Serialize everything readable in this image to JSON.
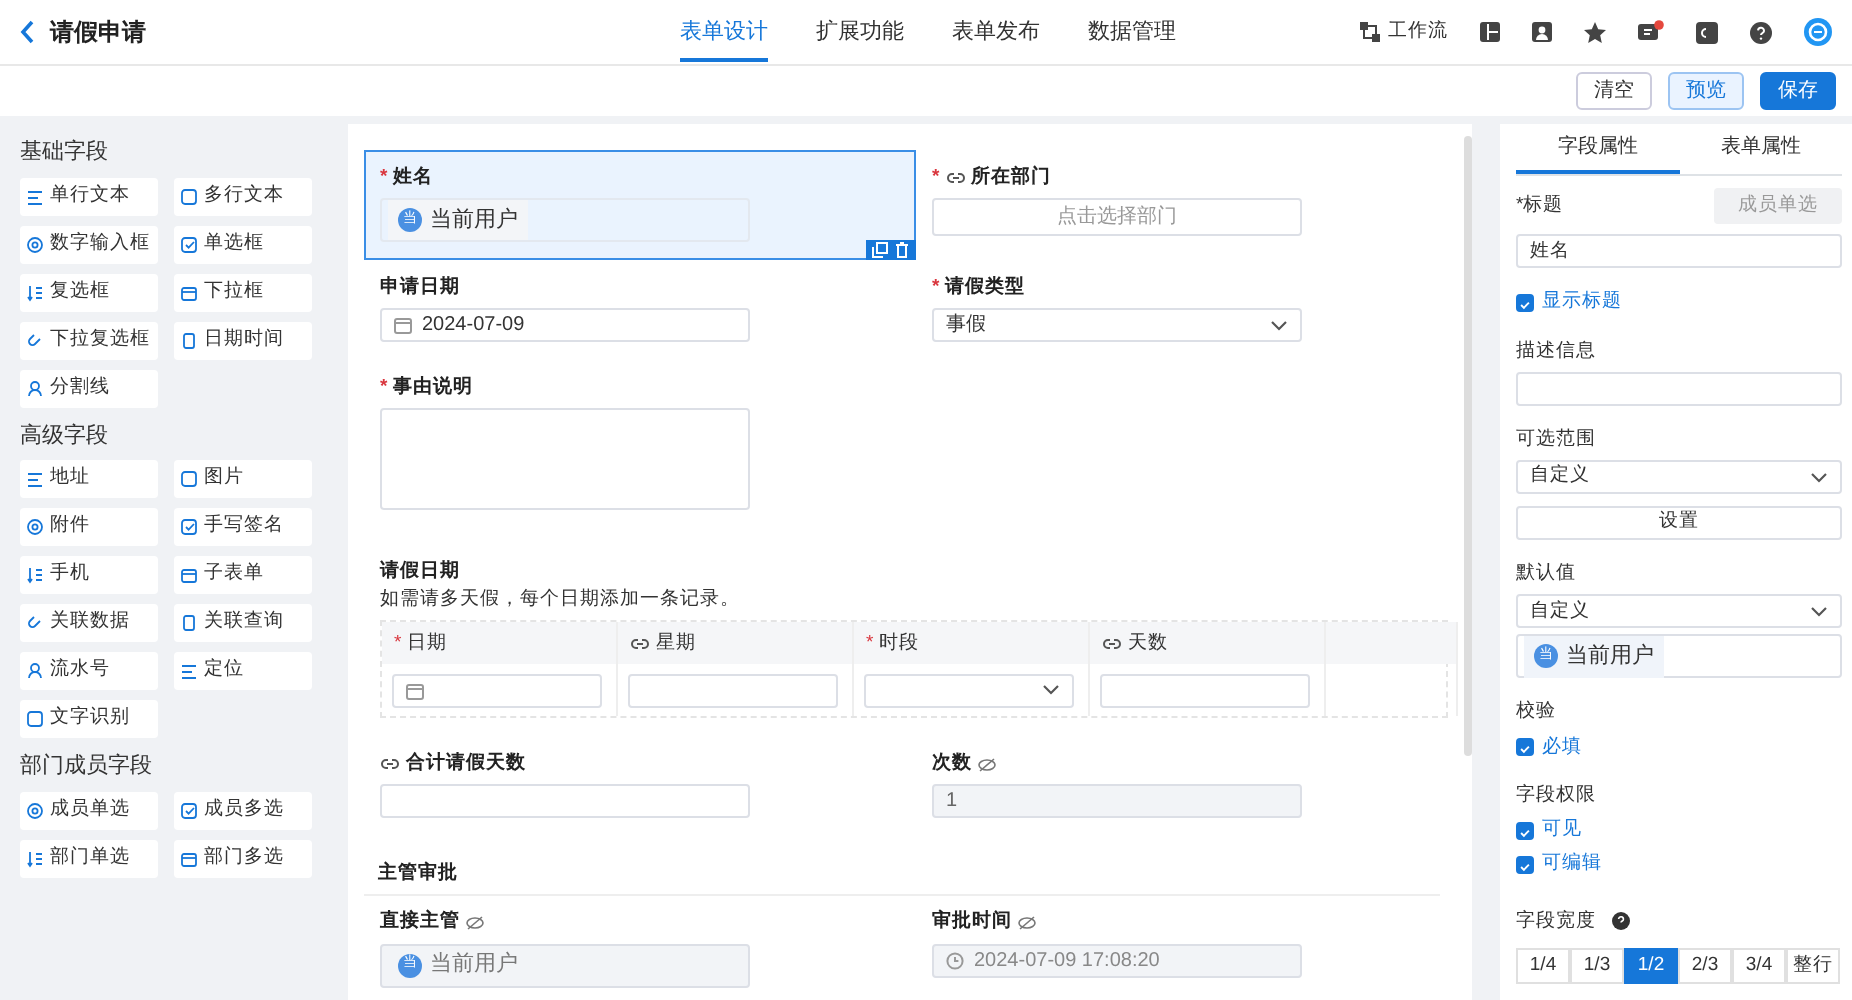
{
  "header": {
    "title": "请假申请",
    "tabs": [
      {
        "label": "表单设计",
        "selected": true
      },
      {
        "label": "扩展功能",
        "selected": false
      },
      {
        "label": "表单发布",
        "selected": false
      },
      {
        "label": "数据管理",
        "selected": false
      }
    ],
    "workflow": "工作流",
    "notice": true
  },
  "actions": [
    {
      "label": "清空",
      "kind": "plain"
    },
    {
      "label": "预览",
      "kind": "soft"
    },
    {
      "label": "保存",
      "kind": "primary"
    }
  ],
  "palette": [
    {
      "title": "基础字段",
      "items": [
        "单行文本",
        "多行文本",
        "数字输入框",
        "单选框",
        "复选框",
        "下拉框",
        "下拉复选框",
        "日期时间",
        "分割线"
      ]
    },
    {
      "title": "高级字段",
      "items": [
        "地址",
        "图片",
        "附件",
        "手写签名",
        "手机",
        "子表单",
        "关联数据",
        "关联查询",
        "流水号",
        "定位",
        "文字识别"
      ]
    },
    {
      "title": "部门成员字段",
      "items": [
        "成员单选",
        "成员多选",
        "部门单选",
        "部门多选"
      ]
    }
  ],
  "fields": [
    {
      "kind": "user",
      "label": "姓名",
      "required_mark": "*",
      "linked": false,
      "hidden": false,
      "selected": true,
      "readonly": false,
      "avatar": "当",
      "value": "当前用户"
    },
    {
      "kind": "picker",
      "label": "所在部门",
      "required_mark": "*",
      "linked": true,
      "hidden": false,
      "selected": false,
      "placeholder": "点击选择部门"
    },
    {
      "kind": "date",
      "label": "申请日期",
      "linked": false,
      "hidden": false,
      "selected": false,
      "value": "2024-07-09"
    },
    {
      "kind": "select",
      "label": "请假类型",
      "required_mark": "*",
      "linked": false,
      "hidden": false,
      "selected": false,
      "value": "事假"
    },
    {
      "kind": "textarea",
      "label": "事由说明",
      "required_mark": "*",
      "linked": false,
      "hidden": false,
      "selected": false
    },
    {
      "kind": "subtable",
      "label": "请假日期",
      "linked": false,
      "hidden": false,
      "selected": false,
      "description": "如需请多天假，每个日期添加一条记录。",
      "columns": [
        {
          "label": "日期",
          "kind": "date",
          "required_mark": "*",
          "linked": false
        },
        {
          "label": "星期",
          "kind": "text",
          "linked": true
        },
        {
          "label": "时段",
          "kind": "select",
          "required_mark": "*",
          "linked": false
        },
        {
          "label": "天数",
          "kind": "text",
          "linked": true
        }
      ]
    },
    {
      "kind": "text",
      "label": "合计请假天数",
      "linked": true,
      "hidden": false,
      "selected": false
    },
    {
      "kind": "readonly",
      "label": "次数",
      "linked": false,
      "hidden": true,
      "selected": false,
      "value": "1"
    },
    {
      "kind": "section",
      "label": "主管审批"
    },
    {
      "kind": "user",
      "label": "直接主管",
      "linked": false,
      "hidden": true,
      "selected": false,
      "readonly": true,
      "avatar": "当",
      "value": "当前用户"
    },
    {
      "kind": "datetime",
      "label": "审批时间",
      "linked": false,
      "hidden": true,
      "selected": false,
      "value": "2024-07-09 17:08:20"
    }
  ],
  "properties": {
    "tabs": [
      {
        "label": "字段属性",
        "selected": true
      },
      {
        "label": "表单属性",
        "selected": false
      }
    ],
    "title_label": "*标题",
    "type_badge": "成员单选",
    "title_value": "姓名",
    "show_title": {
      "label": "显示标题",
      "checked": true
    },
    "description_label": "描述信息",
    "range_label": "可选范围",
    "range_value": "自定义",
    "range_button": "设置",
    "default_label": "默认值",
    "default_value": "自定义",
    "default_user": {
      "avatar": "当",
      "name": "当前用户"
    },
    "validation_label": "校验",
    "validation": [
      {
        "label": "必填",
        "checked": true
      }
    ],
    "permission_label": "字段权限",
    "permissions": [
      {
        "label": "可见",
        "checked": true
      },
      {
        "label": "可编辑",
        "checked": true
      }
    ],
    "width_label": "字段宽度",
    "widths": [
      {
        "label": "1/4",
        "selected": false
      },
      {
        "label": "1/3",
        "selected": false
      },
      {
        "label": "1/2",
        "selected": true
      },
      {
        "label": "2/3",
        "selected": false
      },
      {
        "label": "3/4",
        "selected": false
      },
      {
        "label": "整行",
        "selected": false
      }
    ]
  }
}
